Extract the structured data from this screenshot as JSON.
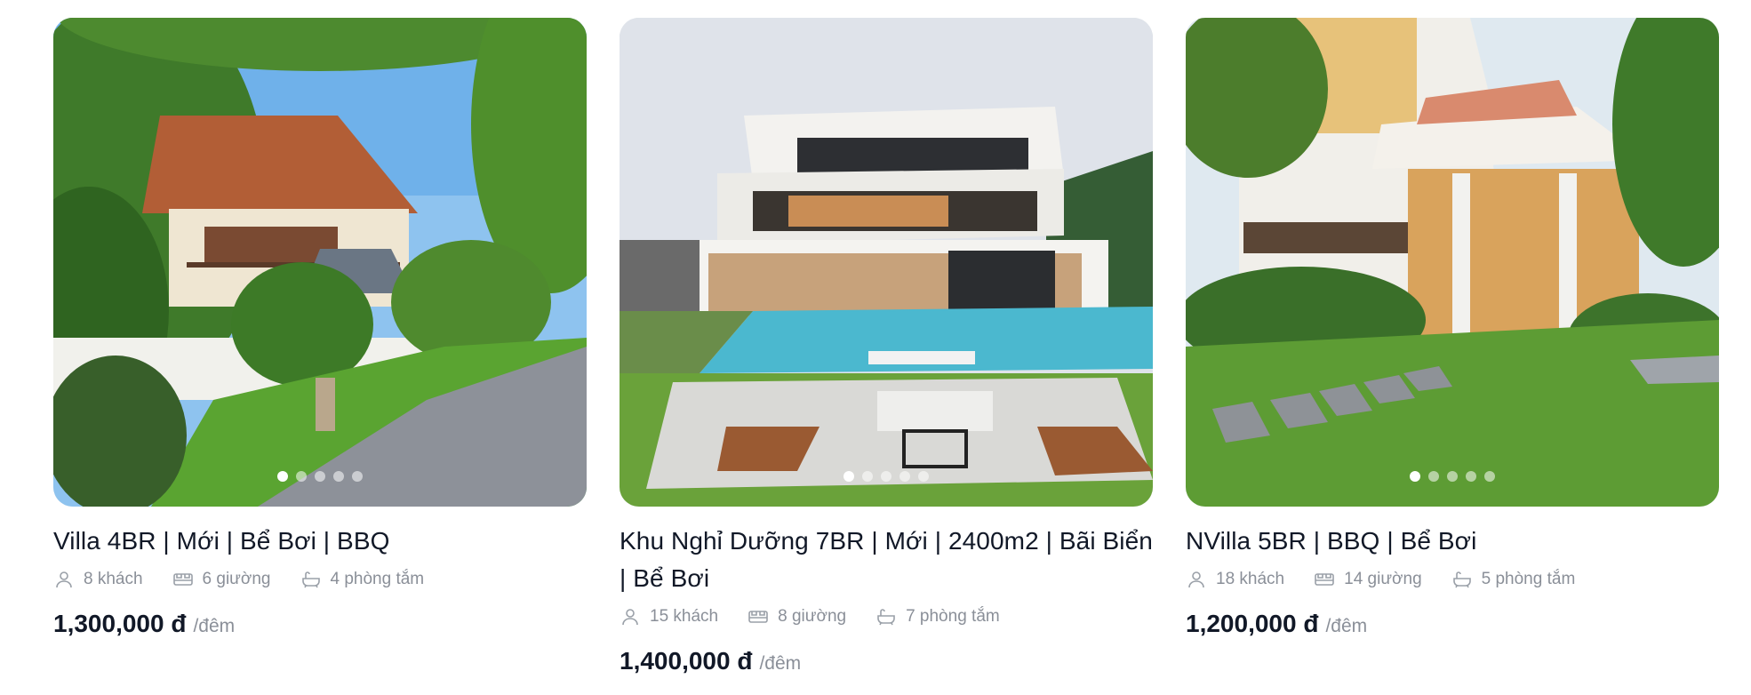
{
  "listings": [
    {
      "title": "Villa 4BR | Mới | Bể Bơi | BBQ",
      "guests": "8 khách",
      "beds": "6 giường",
      "baths": "4 phòng tắm",
      "price": "1,300,000 đ",
      "unit": "/đêm",
      "photo_count": 5,
      "active_photo": 1
    },
    {
      "title": "Khu Nghỉ Dưỡng 7BR | Mới | 2400m2 | Bãi Biển | Bể Bơi",
      "guests": "15 khách",
      "beds": "8 giường",
      "baths": "7 phòng tắm",
      "price": "1,400,000 đ",
      "unit": "/đêm",
      "photo_count": 5,
      "active_photo": 1
    },
    {
      "title": "NVilla 5BR | BBQ | Bể Bơi",
      "guests": "18 khách",
      "beds": "14 giường",
      "baths": "5 phòng tắm",
      "price": "1,200,000 đ",
      "unit": "/đêm",
      "photo_count": 5,
      "active_photo": 1
    }
  ],
  "icons": {
    "guests": "user-icon",
    "beds": "bed-icon",
    "baths": "bathtub-icon"
  },
  "colors": {
    "meta_text": "#8a8f98",
    "title_text": "#111827",
    "price_text": "#111827"
  }
}
